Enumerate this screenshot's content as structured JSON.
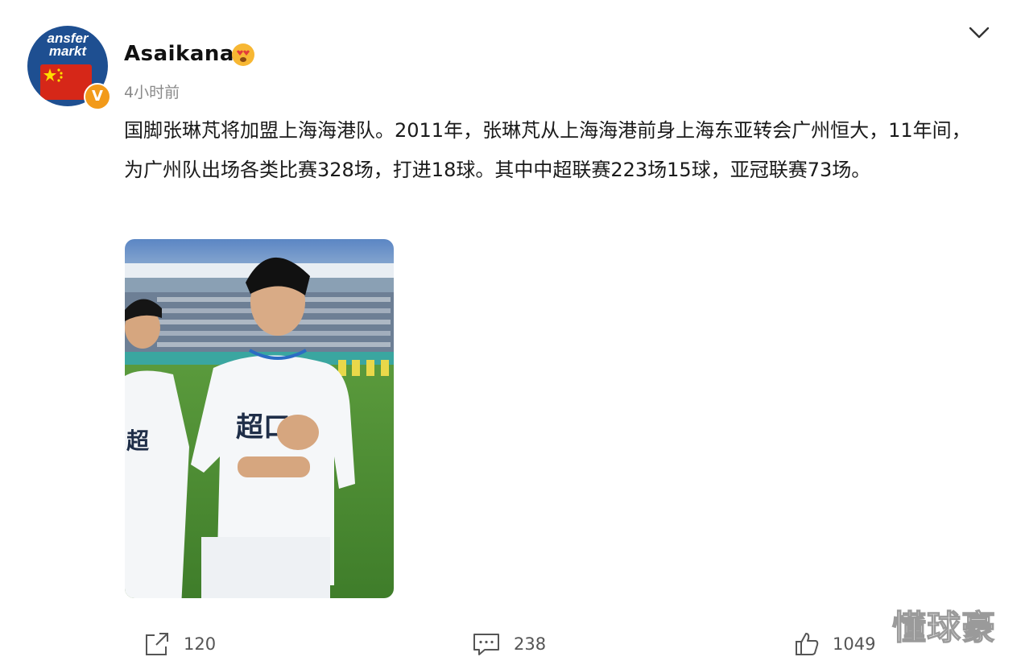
{
  "header": {
    "avatar_logo_line1": "ansfer",
    "avatar_logo_line2": "markt",
    "verified_mark": "V",
    "username": "Asaikana",
    "timestamp": "4小时前"
  },
  "post": {
    "text": "国脚张琳芃将加盟上海海港队。2011年，张琳芃从上海海港前身上海东亚转会广州恒大，11年间，为广州队出场各类比赛328场，打进18球。其中中超联赛223场15球，亚冠联赛73场。",
    "image_alt": "footballer in white jersey with hand on chest in stadium",
    "jersey_text": "超口"
  },
  "actions": {
    "share_count": "120",
    "comment_count": "238",
    "like_count": "1049"
  },
  "watermark": "懂球豪",
  "colors": {
    "accent_orange": "#f29a1a",
    "avatar_blue": "#1e4f91",
    "flag_red": "#d62718",
    "muted_text": "#8a8a8a"
  }
}
